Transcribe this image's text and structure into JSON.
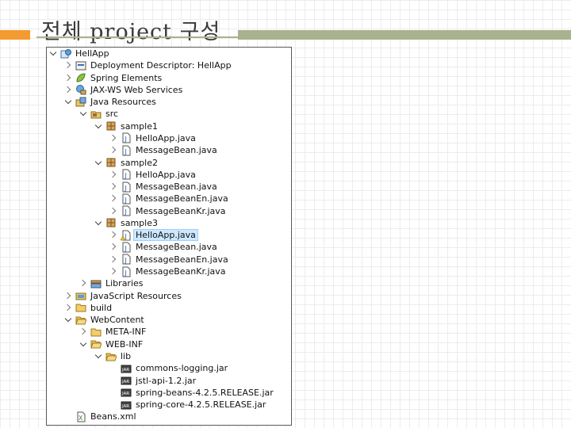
{
  "slide": {
    "title": "전체 project 구성",
    "colors": {
      "accent_orange": "#f39b2e",
      "accent_green": "#a9b28e",
      "selection": "#cde8ff"
    }
  },
  "tree": [
    {
      "label": "HellApp",
      "icon": "web-project-icon",
      "twisty": "expanded",
      "depth": 0
    },
    {
      "label": "Deployment Descriptor: HellApp",
      "icon": "deployment-descriptor-icon",
      "twisty": "collapsed",
      "depth": 1
    },
    {
      "label": "Spring Elements",
      "icon": "spring-leaf-icon",
      "twisty": "collapsed",
      "depth": 1
    },
    {
      "label": "JAX-WS Web Services",
      "icon": "web-services-icon",
      "twisty": "collapsed",
      "depth": 1
    },
    {
      "label": "Java Resources",
      "icon": "java-resources-icon",
      "twisty": "expanded",
      "depth": 1
    },
    {
      "label": "src",
      "icon": "source-folder-icon",
      "twisty": "expanded",
      "depth": 2
    },
    {
      "label": "sample1",
      "icon": "package-icon",
      "twisty": "expanded",
      "depth": 3
    },
    {
      "label": "HelloApp.java",
      "icon": "java-file-icon",
      "twisty": "collapsed",
      "depth": 4
    },
    {
      "label": "MessageBean.java",
      "icon": "java-file-icon",
      "twisty": "collapsed",
      "depth": 4
    },
    {
      "label": "sample2",
      "icon": "package-icon",
      "twisty": "expanded",
      "depth": 3
    },
    {
      "label": "HelloApp.java",
      "icon": "java-file-icon",
      "twisty": "collapsed",
      "depth": 4
    },
    {
      "label": "MessageBean.java",
      "icon": "java-file-icon",
      "twisty": "collapsed",
      "depth": 4
    },
    {
      "label": "MessageBeanEn.java",
      "icon": "java-file-icon",
      "twisty": "collapsed",
      "depth": 4
    },
    {
      "label": "MessageBeanKr.java",
      "icon": "java-file-icon",
      "twisty": "collapsed",
      "depth": 4
    },
    {
      "label": "sample3",
      "icon": "package-icon",
      "twisty": "expanded",
      "depth": 3
    },
    {
      "label": "HelloApp.java",
      "icon": "java-file-warning-icon",
      "twisty": "collapsed",
      "depth": 4,
      "selected": true
    },
    {
      "label": "MessageBean.java",
      "icon": "java-file-icon",
      "twisty": "collapsed",
      "depth": 4
    },
    {
      "label": "MessageBeanEn.java",
      "icon": "java-file-icon",
      "twisty": "collapsed",
      "depth": 4
    },
    {
      "label": "MessageBeanKr.java",
      "icon": "java-file-icon",
      "twisty": "collapsed",
      "depth": 4
    },
    {
      "label": "Libraries",
      "icon": "libraries-icon",
      "twisty": "collapsed",
      "depth": 2
    },
    {
      "label": "JavaScript Resources",
      "icon": "javascript-resources-icon",
      "twisty": "collapsed",
      "depth": 1
    },
    {
      "label": "build",
      "icon": "folder-icon",
      "twisty": "collapsed",
      "depth": 1
    },
    {
      "label": "WebContent",
      "icon": "folder-open-icon",
      "twisty": "expanded",
      "depth": 1
    },
    {
      "label": "META-INF",
      "icon": "folder-icon",
      "twisty": "collapsed",
      "depth": 2
    },
    {
      "label": "WEB-INF",
      "icon": "folder-open-icon",
      "twisty": "expanded",
      "depth": 2
    },
    {
      "label": "lib",
      "icon": "folder-open-icon",
      "twisty": "expanded",
      "depth": 3
    },
    {
      "label": "commons-logging.jar",
      "icon": "jar-icon",
      "twisty": "none",
      "depth": 4
    },
    {
      "label": "jstl-api-1.2.jar",
      "icon": "jar-icon",
      "twisty": "none",
      "depth": 4
    },
    {
      "label": "spring-beans-4.2.5.RELEASE.jar",
      "icon": "jar-icon",
      "twisty": "none",
      "depth": 4
    },
    {
      "label": "spring-core-4.2.5.RELEASE.jar",
      "icon": "jar-icon",
      "twisty": "none",
      "depth": 4
    },
    {
      "label": "Beans.xml",
      "icon": "xml-file-icon",
      "twisty": "none",
      "depth": 1
    }
  ]
}
